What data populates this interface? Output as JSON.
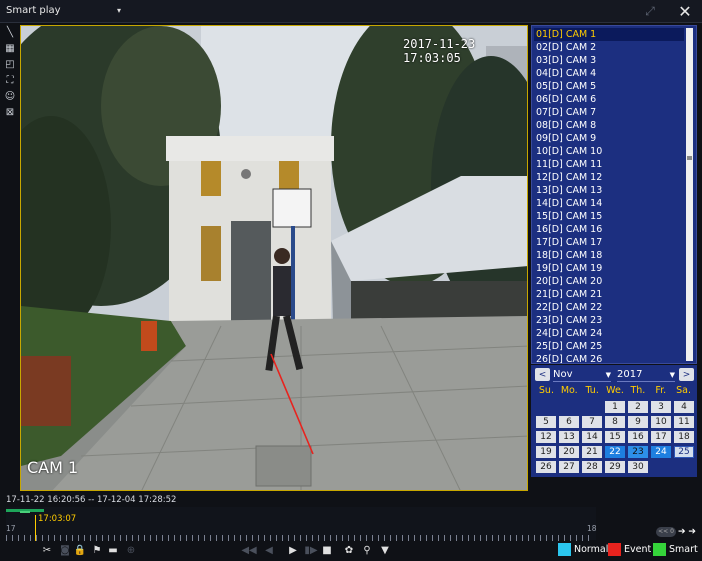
{
  "window": {
    "mode_label": "Smart play",
    "mode_caret": "▾",
    "fullscreen_icon": "⤢",
    "close_icon": "✕"
  },
  "left_toolbar": [
    {
      "name": "draw-line-icon",
      "glyph": "╲"
    },
    {
      "name": "grid-icon",
      "glyph": "▦"
    },
    {
      "name": "region-icon",
      "glyph": "◰"
    },
    {
      "name": "expand-icon",
      "glyph": "⛶"
    },
    {
      "name": "person-icon",
      "glyph": "☺"
    },
    {
      "name": "clear-icon",
      "glyph": "⊠"
    }
  ],
  "video": {
    "osd_time": "2017-11-23 17:03:05",
    "osd_channel": "CAM 1"
  },
  "channels": [
    "01[D] CAM 1",
    "02[D] CAM 2",
    "03[D] CAM 3",
    "04[D] CAM 4",
    "05[D] CAM 5",
    "06[D] CAM 6",
    "07[D] CAM 7",
    "08[D] CAM 8",
    "09[D] CAM 9",
    "10[D] CAM 10",
    "11[D] CAM 11",
    "12[D] CAM 12",
    "13[D] CAM 13",
    "14[D] CAM 14",
    "15[D] CAM 15",
    "16[D] CAM 16",
    "17[D] CAM 17",
    "18[D] CAM 18",
    "19[D] CAM 19",
    "20[D] CAM 20",
    "21[D] CAM 21",
    "22[D] CAM 22",
    "23[D] CAM 23",
    "24[D] CAM 24",
    "25[D] CAM 25",
    "26[D] CAM 26"
  ],
  "selected_channel": 0,
  "calendar": {
    "prev": "<",
    "next": ">",
    "month": "Nov",
    "year": "2017",
    "weekdays": [
      "Su.",
      "Mo.",
      "Tu.",
      "We.",
      "Th.",
      "Fr.",
      "Sa."
    ],
    "first_weekday": 3,
    "days_in_month": 30,
    "record_days": [
      22,
      23,
      24,
      25
    ],
    "strong_days": [
      22,
      24
    ],
    "selected_day": 23
  },
  "timeline": {
    "range": "17-11-22 16:20:56 -- 17-12-04 17:28:52",
    "cursor_time": "17:03:07",
    "tick_start": "17",
    "tick_end": "18",
    "zoom_pill": "<< 0",
    "zoom_arrows": "➔ ➔"
  },
  "bottom_toolbar": [
    {
      "name": "scissors-icon",
      "glyph": "✂",
      "dim": false
    },
    {
      "name": "snapshot-icon",
      "glyph": "◙",
      "dim": true
    },
    {
      "name": "lock-icon",
      "glyph": "🔒",
      "dim": false
    },
    {
      "name": "flag-icon",
      "glyph": "⚑",
      "dim": false
    },
    {
      "name": "folder-icon",
      "glyph": "▬",
      "dim": false
    },
    {
      "name": "zoom-in-icon",
      "glyph": "⊕",
      "dim": true
    },
    {
      "name": "rewind-icon",
      "glyph": "◀◀",
      "dim": true
    },
    {
      "name": "slow-icon",
      "glyph": "◀",
      "dim": true
    },
    {
      "name": "play-icon",
      "glyph": "▶",
      "dim": false
    },
    {
      "name": "step-icon",
      "glyph": "▮▶",
      "dim": true
    },
    {
      "name": "stop-icon",
      "glyph": "■",
      "dim": false
    },
    {
      "name": "settings-icon",
      "glyph": "✿",
      "dim": false
    },
    {
      "name": "search-icon",
      "glyph": "⚲",
      "dim": false
    },
    {
      "name": "filter-icon",
      "glyph": "▼",
      "dim": false
    }
  ],
  "legend": [
    {
      "label": "Normal",
      "color": "#2bc6ee"
    },
    {
      "label": "Event",
      "color": "#e8231e"
    },
    {
      "label": "Smart",
      "color": "#35d43a"
    }
  ]
}
